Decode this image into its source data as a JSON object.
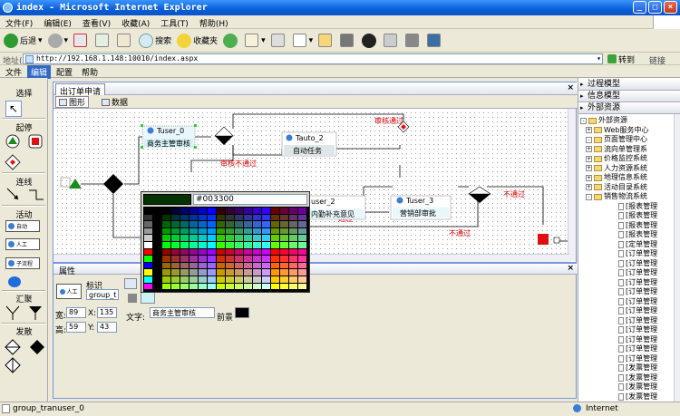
{
  "window": {
    "title": "index - Microsoft Internet Explorer"
  },
  "ie_menu": [
    "文件(F)",
    "编辑(E)",
    "查看(V)",
    "收藏(A)",
    "工具(T)",
    "帮助(H)"
  ],
  "toolbar": {
    "back": "后退",
    "search": "搜索",
    "favorites": "收藏夹"
  },
  "address": {
    "label": "地址(D)",
    "url": "http://192.168.1.148:10010/index.aspx",
    "go": "转到",
    "links": "链接"
  },
  "app_menu": {
    "items": [
      "文件",
      "编辑",
      "配置",
      "帮助"
    ],
    "selected": 1
  },
  "palette_tools": {
    "select": "选择",
    "start": "起停",
    "connect": "连线",
    "activity": "活动",
    "btn_auto": "自动",
    "btn_manual": "人工",
    "btn_subflow": "子流程",
    "join": "汇聚",
    "fork": "发散"
  },
  "canvas": {
    "tab": "出订单申请",
    "view_graph": "图形",
    "view_data": "数据",
    "nodes": {
      "tuser0_name": "Tuser_0",
      "tuser0_label": "商务主管审核",
      "tauto2_name": "Tauto_2",
      "tauto2_label": "自动任务",
      "tuser2_name": "user_2",
      "tuser2_label": "内勤补充意见",
      "tuser3_name": "Tuser_3",
      "tuser3_label": "营销部审批"
    },
    "edges": {
      "fail1": "审核不通过",
      "pass1": "审核通过",
      "pass2": "通过",
      "fail2": "不通过",
      "fail3": "不通过"
    }
  },
  "color_picker": {
    "value": "#003300",
    "preview": "#003300"
  },
  "props": {
    "title": "属性",
    "id_label": "标识",
    "id_value": "group_t",
    "node_caption": "人工",
    "w_label": "宽:",
    "w": "89",
    "x_label": "X:",
    "x": "135",
    "h_label": "高:",
    "h": "59",
    "y_label": "Y:",
    "y": "43",
    "text_label": "文字:",
    "text_value": "商务主管审核",
    "bg_label": "前景"
  },
  "right": {
    "hdr1": "过程模型",
    "hdr2": "信息模型",
    "hdr3": "外部资源",
    "tree_root": "外部资源",
    "tree_items": [
      "Web服务中心",
      "页面管理中心",
      "流向单管理系",
      "价格监控系统",
      "人力资源系统",
      "地理信息系统",
      "活动目录系统",
      "销售物流系统"
    ],
    "leaf_items": [
      "[报表管理",
      "[报表管理",
      "[报表管理",
      "[报表管理",
      "[定单管理",
      "[订单管理",
      "[订单管理",
      "[订单管理",
      "[订单管理",
      "[订单管理",
      "[订单管理",
      "[订单管理",
      "[订单管理",
      "[订单管理",
      "[订单管理",
      "[订单管理",
      "[订单管理",
      "[发票管理",
      "[发票管理",
      "[发票管理",
      "[发票管理"
    ]
  },
  "status": {
    "left": "group_tranuser_0",
    "zone": "Internet"
  }
}
